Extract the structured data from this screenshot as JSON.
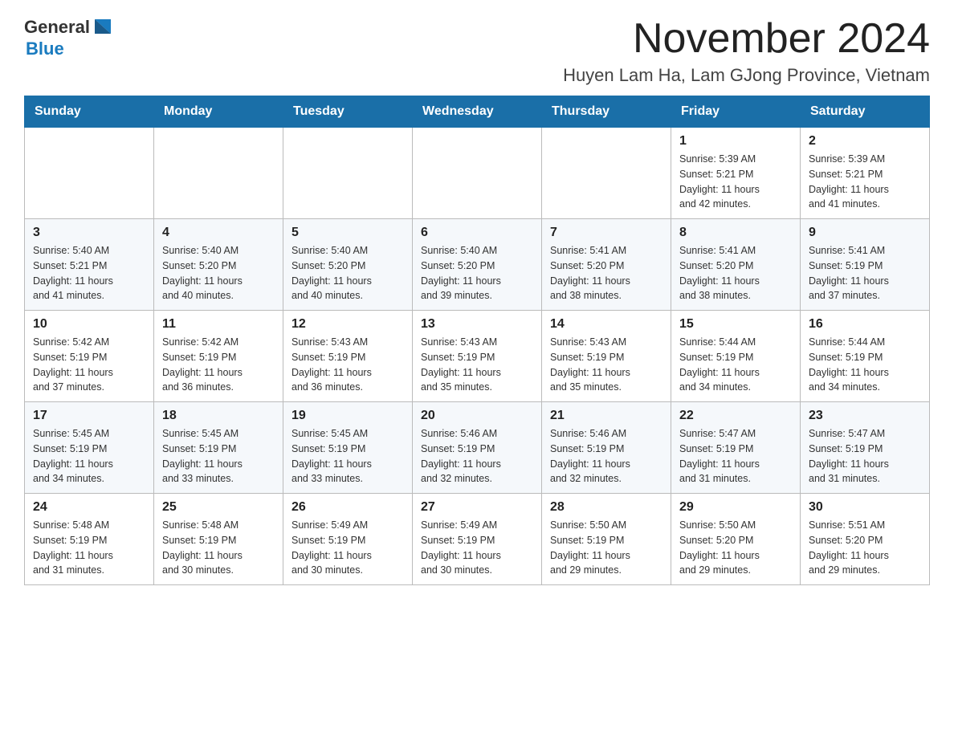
{
  "header": {
    "logo_general": "General",
    "logo_blue": "Blue",
    "month_title": "November 2024",
    "subtitle": "Huyen Lam Ha, Lam GJong Province, Vietnam"
  },
  "days_of_week": [
    "Sunday",
    "Monday",
    "Tuesday",
    "Wednesday",
    "Thursday",
    "Friday",
    "Saturday"
  ],
  "weeks": [
    {
      "days": [
        {
          "number": "",
          "info": ""
        },
        {
          "number": "",
          "info": ""
        },
        {
          "number": "",
          "info": ""
        },
        {
          "number": "",
          "info": ""
        },
        {
          "number": "",
          "info": ""
        },
        {
          "number": "1",
          "info": "Sunrise: 5:39 AM\nSunset: 5:21 PM\nDaylight: 11 hours\nand 42 minutes."
        },
        {
          "number": "2",
          "info": "Sunrise: 5:39 AM\nSunset: 5:21 PM\nDaylight: 11 hours\nand 41 minutes."
        }
      ]
    },
    {
      "days": [
        {
          "number": "3",
          "info": "Sunrise: 5:40 AM\nSunset: 5:21 PM\nDaylight: 11 hours\nand 41 minutes."
        },
        {
          "number": "4",
          "info": "Sunrise: 5:40 AM\nSunset: 5:20 PM\nDaylight: 11 hours\nand 40 minutes."
        },
        {
          "number": "5",
          "info": "Sunrise: 5:40 AM\nSunset: 5:20 PM\nDaylight: 11 hours\nand 40 minutes."
        },
        {
          "number": "6",
          "info": "Sunrise: 5:40 AM\nSunset: 5:20 PM\nDaylight: 11 hours\nand 39 minutes."
        },
        {
          "number": "7",
          "info": "Sunrise: 5:41 AM\nSunset: 5:20 PM\nDaylight: 11 hours\nand 38 minutes."
        },
        {
          "number": "8",
          "info": "Sunrise: 5:41 AM\nSunset: 5:20 PM\nDaylight: 11 hours\nand 38 minutes."
        },
        {
          "number": "9",
          "info": "Sunrise: 5:41 AM\nSunset: 5:19 PM\nDaylight: 11 hours\nand 37 minutes."
        }
      ]
    },
    {
      "days": [
        {
          "number": "10",
          "info": "Sunrise: 5:42 AM\nSunset: 5:19 PM\nDaylight: 11 hours\nand 37 minutes."
        },
        {
          "number": "11",
          "info": "Sunrise: 5:42 AM\nSunset: 5:19 PM\nDaylight: 11 hours\nand 36 minutes."
        },
        {
          "number": "12",
          "info": "Sunrise: 5:43 AM\nSunset: 5:19 PM\nDaylight: 11 hours\nand 36 minutes."
        },
        {
          "number": "13",
          "info": "Sunrise: 5:43 AM\nSunset: 5:19 PM\nDaylight: 11 hours\nand 35 minutes."
        },
        {
          "number": "14",
          "info": "Sunrise: 5:43 AM\nSunset: 5:19 PM\nDaylight: 11 hours\nand 35 minutes."
        },
        {
          "number": "15",
          "info": "Sunrise: 5:44 AM\nSunset: 5:19 PM\nDaylight: 11 hours\nand 34 minutes."
        },
        {
          "number": "16",
          "info": "Sunrise: 5:44 AM\nSunset: 5:19 PM\nDaylight: 11 hours\nand 34 minutes."
        }
      ]
    },
    {
      "days": [
        {
          "number": "17",
          "info": "Sunrise: 5:45 AM\nSunset: 5:19 PM\nDaylight: 11 hours\nand 34 minutes."
        },
        {
          "number": "18",
          "info": "Sunrise: 5:45 AM\nSunset: 5:19 PM\nDaylight: 11 hours\nand 33 minutes."
        },
        {
          "number": "19",
          "info": "Sunrise: 5:45 AM\nSunset: 5:19 PM\nDaylight: 11 hours\nand 33 minutes."
        },
        {
          "number": "20",
          "info": "Sunrise: 5:46 AM\nSunset: 5:19 PM\nDaylight: 11 hours\nand 32 minutes."
        },
        {
          "number": "21",
          "info": "Sunrise: 5:46 AM\nSunset: 5:19 PM\nDaylight: 11 hours\nand 32 minutes."
        },
        {
          "number": "22",
          "info": "Sunrise: 5:47 AM\nSunset: 5:19 PM\nDaylight: 11 hours\nand 31 minutes."
        },
        {
          "number": "23",
          "info": "Sunrise: 5:47 AM\nSunset: 5:19 PM\nDaylight: 11 hours\nand 31 minutes."
        }
      ]
    },
    {
      "days": [
        {
          "number": "24",
          "info": "Sunrise: 5:48 AM\nSunset: 5:19 PM\nDaylight: 11 hours\nand 31 minutes."
        },
        {
          "number": "25",
          "info": "Sunrise: 5:48 AM\nSunset: 5:19 PM\nDaylight: 11 hours\nand 30 minutes."
        },
        {
          "number": "26",
          "info": "Sunrise: 5:49 AM\nSunset: 5:19 PM\nDaylight: 11 hours\nand 30 minutes."
        },
        {
          "number": "27",
          "info": "Sunrise: 5:49 AM\nSunset: 5:19 PM\nDaylight: 11 hours\nand 30 minutes."
        },
        {
          "number": "28",
          "info": "Sunrise: 5:50 AM\nSunset: 5:19 PM\nDaylight: 11 hours\nand 29 minutes."
        },
        {
          "number": "29",
          "info": "Sunrise: 5:50 AM\nSunset: 5:20 PM\nDaylight: 11 hours\nand 29 minutes."
        },
        {
          "number": "30",
          "info": "Sunrise: 5:51 AM\nSunset: 5:20 PM\nDaylight: 11 hours\nand 29 minutes."
        }
      ]
    }
  ]
}
